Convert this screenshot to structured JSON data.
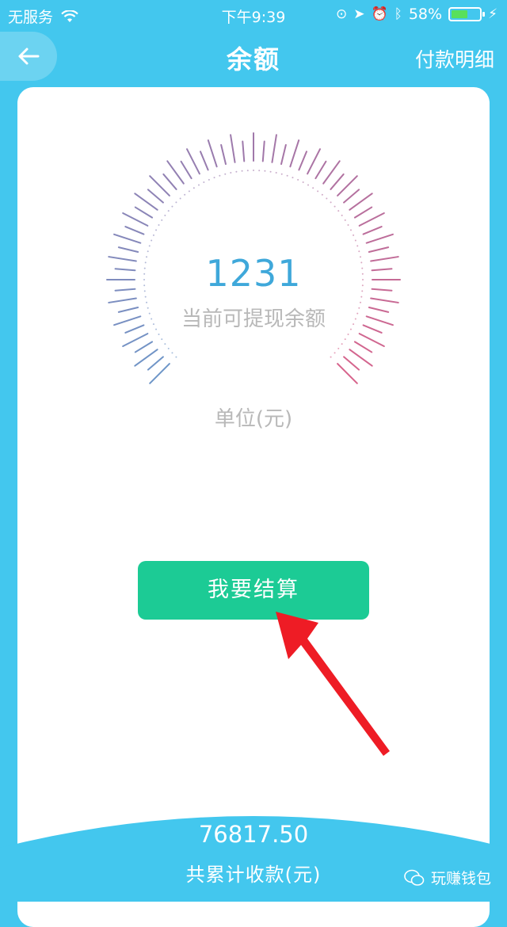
{
  "status": {
    "carrier": "无服务",
    "time": "下午9:39",
    "battery": "58%",
    "battery_level": 0.58
  },
  "nav": {
    "title": "余额",
    "right_link": "付款明细"
  },
  "balance": {
    "amount": "1231",
    "label": "当前可提现余额",
    "unit": "单位(元)"
  },
  "action": {
    "settle_label": "我要结算"
  },
  "summary": {
    "total": "76817.50",
    "total_label": "共累计收款(元)"
  },
  "watermark": {
    "text": "玩赚钱包"
  },
  "colors": {
    "background": "#43c7ee",
    "button": "#1ccb95",
    "amount": "#3fa8da",
    "arrow": "#ee1c25"
  }
}
